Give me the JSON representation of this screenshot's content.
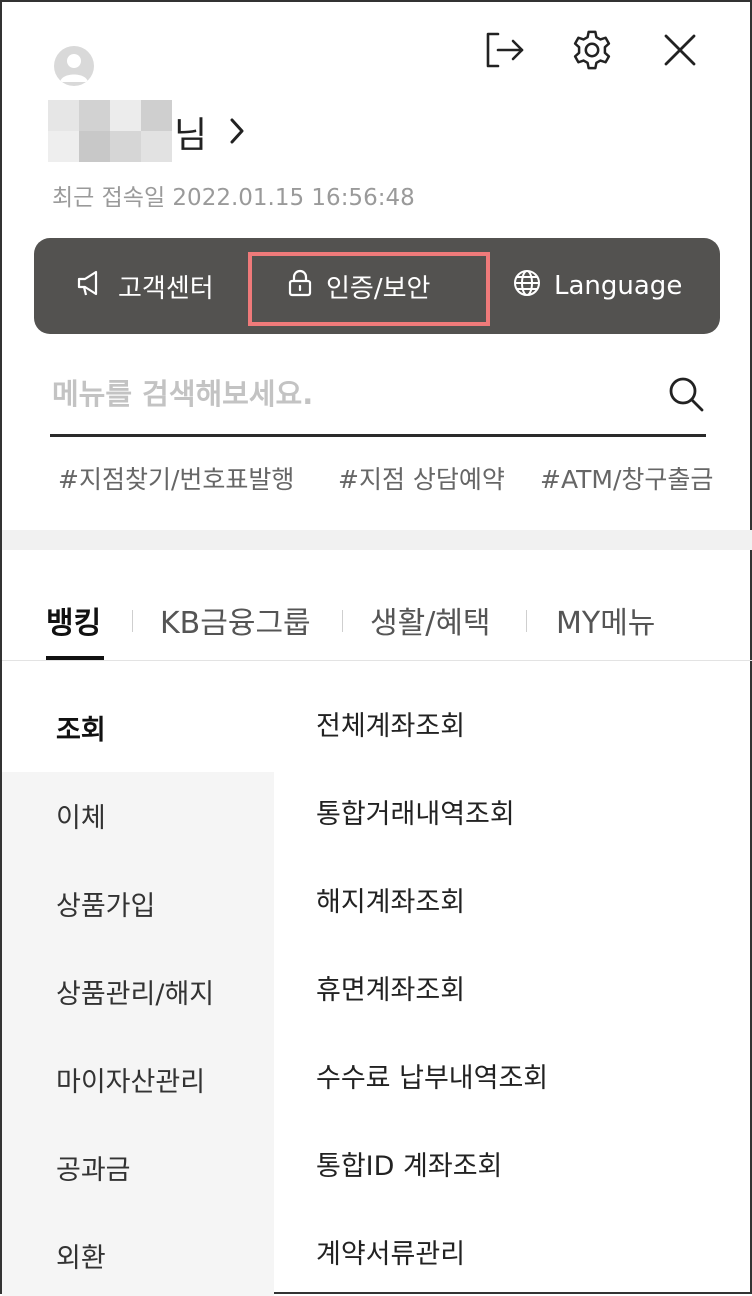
{
  "header": {
    "icons": [
      "logout-icon",
      "gear-icon",
      "close-icon"
    ],
    "user_suffix": "님",
    "last_login": "최근 접속일 2022.01.15 16:56:48"
  },
  "quickbar": {
    "customer_center": "고객센터",
    "auth_security": "인증/보안",
    "language": "Language"
  },
  "search": {
    "placeholder": "메뉴를 검색해보세요."
  },
  "tags": [
    "#지점찾기/번호표발행",
    "#지점 상담예약",
    "#ATM/창구출금"
  ],
  "tabs": [
    "뱅킹",
    "KB금융그룹",
    "생활/혜택",
    "MY메뉴"
  ],
  "sidebar": [
    "조회",
    "이체",
    "상품가입",
    "상품관리/해지",
    "마이자산관리",
    "공과금",
    "외환"
  ],
  "submenu": [
    "전체계좌조회",
    "통합거래내역조회",
    "해지계좌조회",
    "휴면계좌조회",
    "수수료 납부내역조회",
    "통합ID 계좌조회",
    "계약서류관리"
  ],
  "colors": {
    "quickbar_bg": "#535250",
    "highlight": "#ef7a7a"
  }
}
